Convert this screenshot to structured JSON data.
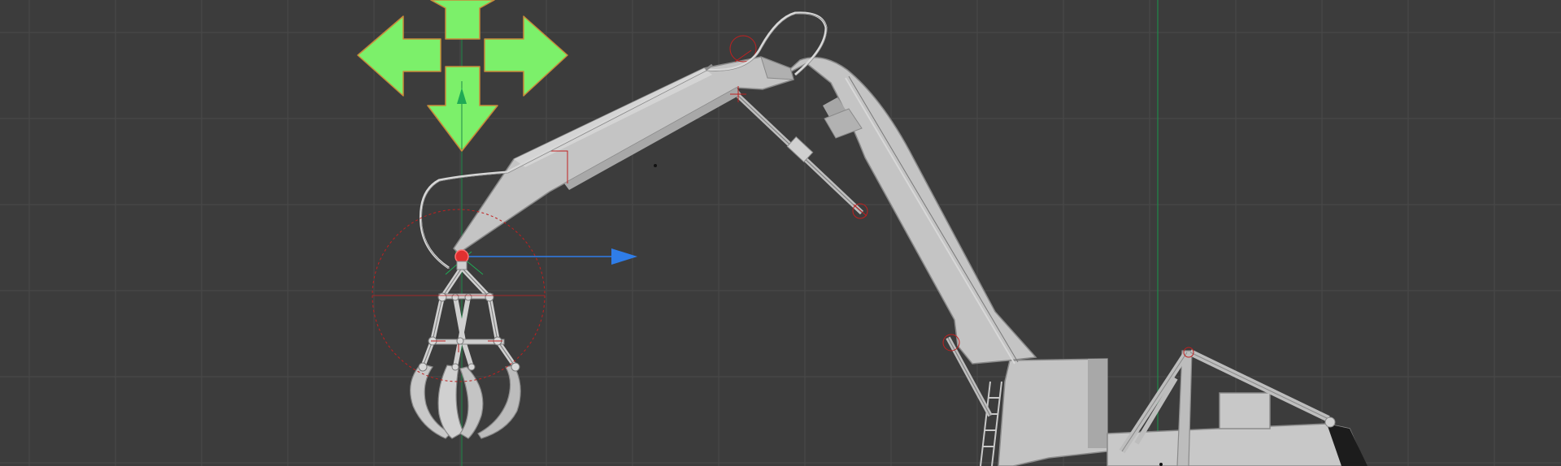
{
  "app": {
    "view": "3D viewport",
    "background_color": "#3c3c3c",
    "grid_color": "#4a4a4a",
    "axis_y_color": "#1e8a4a",
    "axis_x_color": "#2f6fe0"
  },
  "gizmo": {
    "move_handle_color": "#7cf06a",
    "move_handle_outline": "#c88a3a",
    "x_arrow_color": "#2f7de8",
    "y_arrow_color": "#1faa55",
    "pivot_color": "#e03030",
    "rotate_circle_color": "#c02020"
  },
  "model": {
    "name": "material-handler-excavator",
    "body_color": "#c4c4c4",
    "shade_color": "#9a9a9a",
    "hose_color": "#d8d8d8"
  }
}
